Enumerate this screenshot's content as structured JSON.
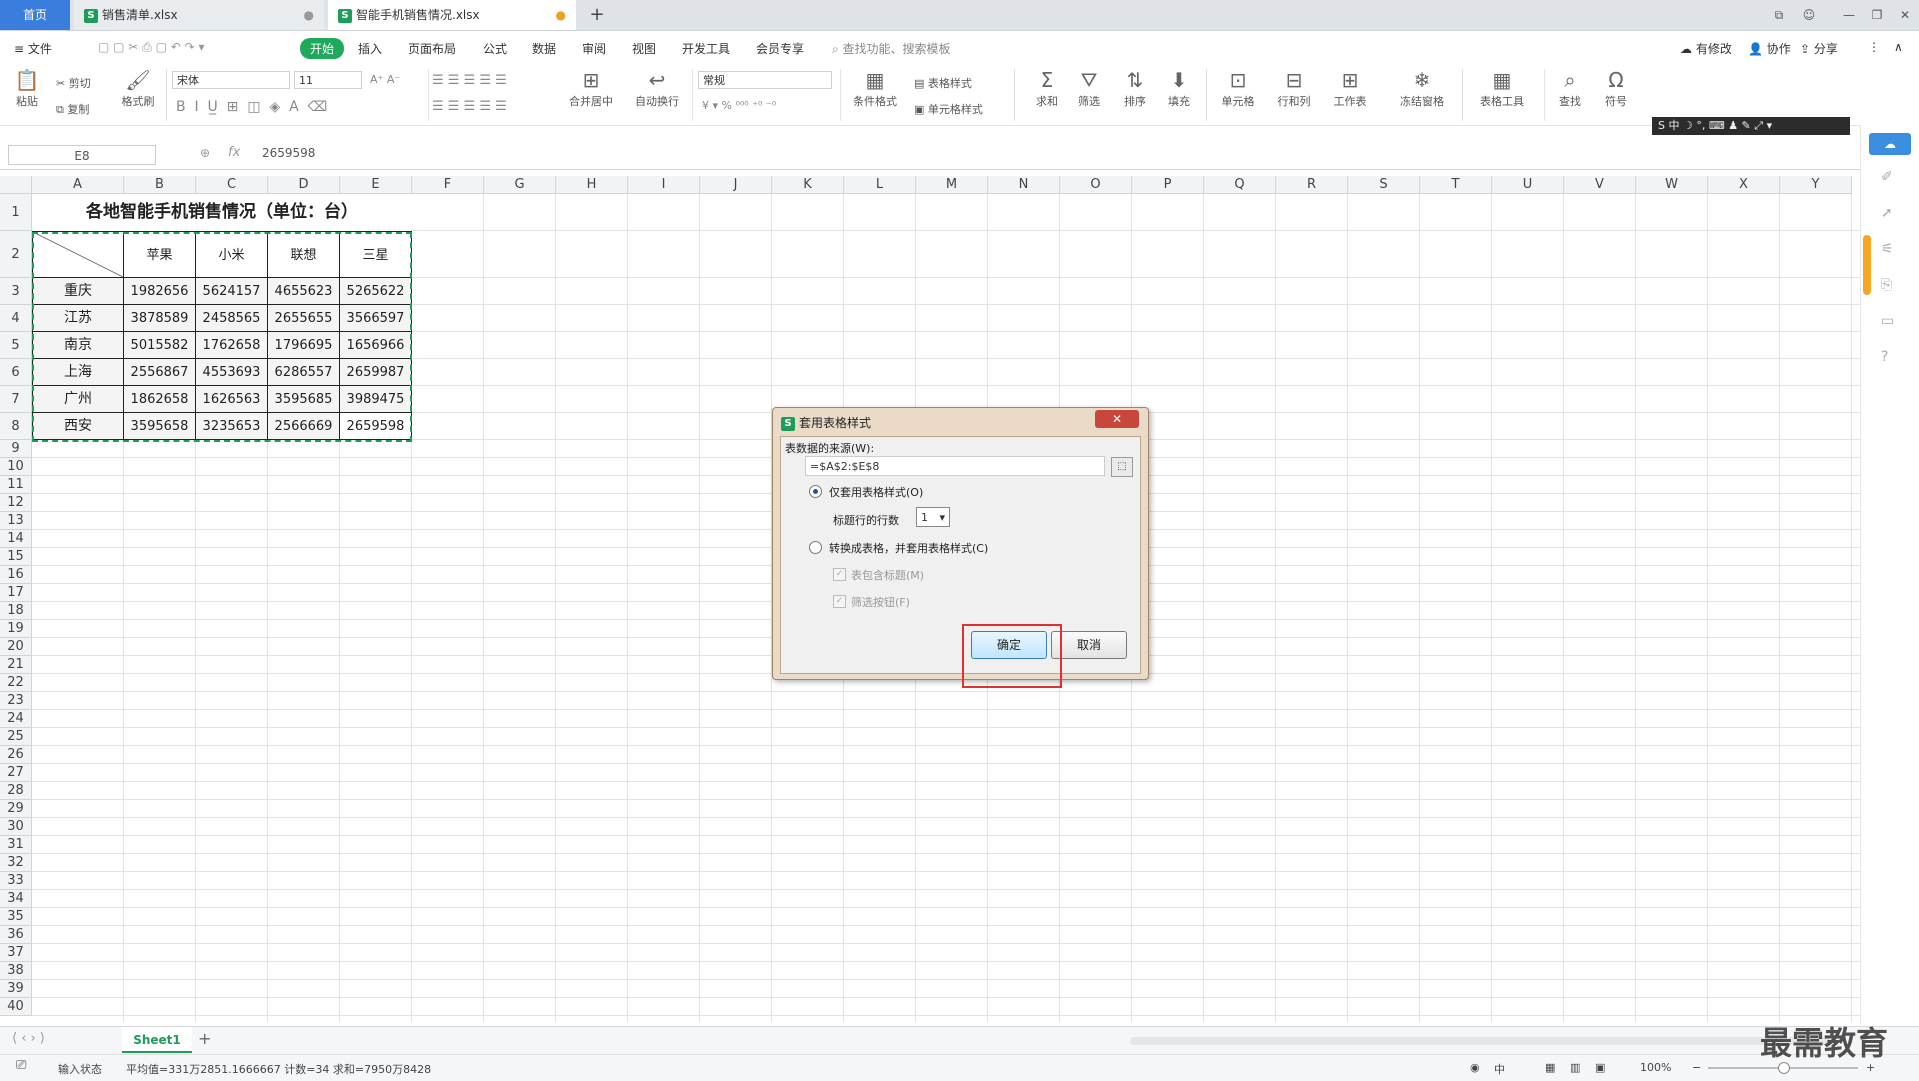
{
  "tabs": {
    "home": "首页",
    "file1": "销售清单.xlsx",
    "file2": "智能手机销售情况.xlsx",
    "add": "+"
  },
  "menubar": {
    "file": "≡ 文件",
    "items": [
      "开始",
      "插入",
      "页面布局",
      "公式",
      "数据",
      "审阅",
      "视图",
      "开发工具",
      "会员专享"
    ],
    "search": "查找功能、搜索模板",
    "right": [
      "有修改",
      "协作",
      "分享"
    ]
  },
  "ribbon": {
    "paste": "粘贴",
    "cut": "剪切",
    "copy": "复制",
    "format_painter": "格式刷",
    "font_name": "宋体",
    "font_size": "11",
    "merge_center": "合并居中",
    "auto_wrap": "自动换行",
    "number_format": "常规",
    "table_style": "表格样式",
    "cell_style": "单元格样式",
    "cond_format": "条件格式",
    "sum": "求和",
    "filter": "筛选",
    "sort": "排序",
    "fill": "填充",
    "cell": "单元格",
    "row_col": "行和列",
    "worksheet": "工作表",
    "freeze": "冻结窗格",
    "table_tools": "表格工具",
    "find": "查找",
    "symbol": "符号"
  },
  "formula_bar": {
    "name_box": "E8",
    "fx": "fx",
    "value": "2659598"
  },
  "grid": {
    "columns": [
      "A",
      "B",
      "C",
      "D",
      "E",
      "F",
      "G",
      "H",
      "I",
      "J",
      "K",
      "L",
      "M",
      "N",
      "O",
      "P",
      "Q",
      "R",
      "S",
      "T",
      "U",
      "V",
      "W",
      "X",
      "Y"
    ],
    "rows": [
      "1",
      "2",
      "3",
      "4",
      "5",
      "6",
      "7",
      "8",
      "9",
      "10",
      "11",
      "12",
      "13",
      "14",
      "15",
      "16",
      "17",
      "18",
      "19",
      "20",
      "21",
      "22",
      "23",
      "24",
      "25",
      "26",
      "27",
      "28",
      "29",
      "30",
      "31",
      "32",
      "33",
      "34",
      "35",
      "36",
      "37",
      "38",
      "39",
      "40"
    ],
    "title": "各地智能手机销售情况（单位：台）",
    "headers": [
      "苹果",
      "小米",
      "联想",
      "三星"
    ],
    "data": [
      [
        "重庆",
        "1982656",
        "5624157",
        "4655623",
        "5265622"
      ],
      [
        "江苏",
        "3878589",
        "2458565",
        "2655655",
        "3566597"
      ],
      [
        "南京",
        "5015582",
        "1762658",
        "1796695",
        "1656966"
      ],
      [
        "上海",
        "2556867",
        "4553693",
        "6286557",
        "2659987"
      ],
      [
        "广州",
        "1862658",
        "1626563",
        "3595685",
        "3989475"
      ],
      [
        "西安",
        "3595658",
        "3235653",
        "2566669",
        "2659598"
      ]
    ]
  },
  "dialog": {
    "title": "套用表格样式",
    "source_label": "表数据的来源(W):",
    "source_value": "=$A$2:$E$8",
    "option1": "仅套用表格样式(O)",
    "header_rows_label": "标题行的行数",
    "header_rows_value": "1",
    "option2": "转换成表格，并套用表格样式(C)",
    "check1": "表包含标题(M)",
    "check2": "筛选按钮(F)",
    "ok": "确定",
    "cancel": "取消"
  },
  "sheet": {
    "tab": "Sheet1"
  },
  "status": {
    "mode": "输入状态",
    "stats": "平均值=331万2851.1666667  计数=34  求和=7950万8428",
    "input_method": "中",
    "zoom": "100%"
  },
  "watermark": "最需教育",
  "colors": {
    "accent_green": "#1fa95b",
    "tab_blue": "#3b7ddd",
    "highlight_red": "#e0302f",
    "selection_dash": "#1e9c5a"
  }
}
